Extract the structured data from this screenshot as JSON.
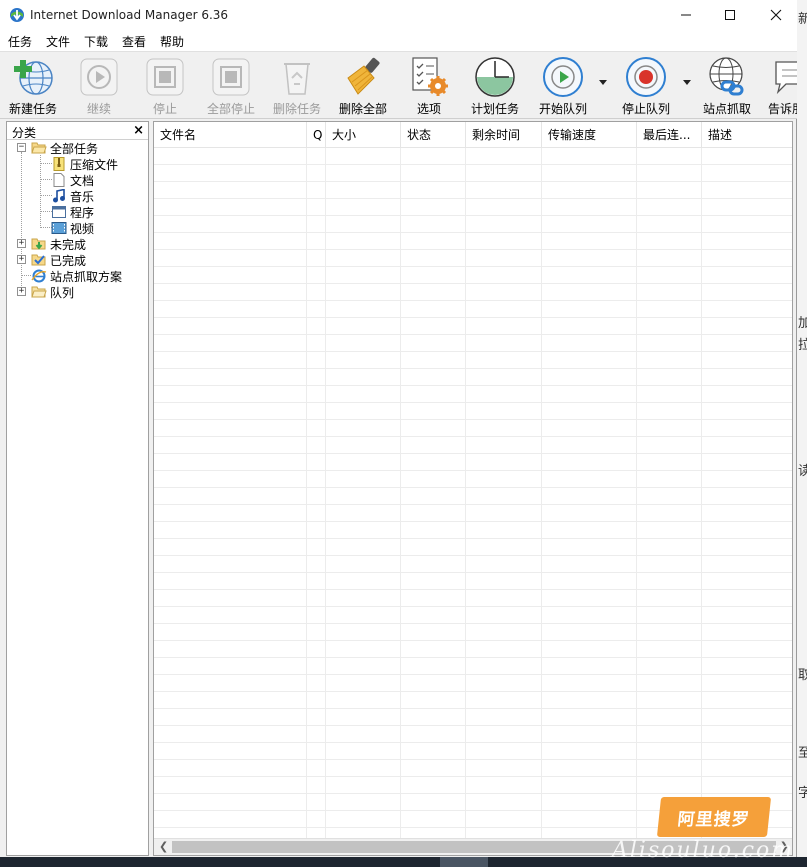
{
  "window": {
    "title": "Internet Download Manager 6.36"
  },
  "menu": [
    "任务",
    "文件",
    "下载",
    "查看",
    "帮助"
  ],
  "toolbar": [
    {
      "label": "新建任务",
      "icon": "add-download-icon",
      "enabled": true
    },
    {
      "label": "继续",
      "icon": "resume-icon",
      "enabled": false
    },
    {
      "label": "停止",
      "icon": "stop-icon",
      "enabled": false
    },
    {
      "label": "全部停止",
      "icon": "stop-all-icon",
      "enabled": false
    },
    {
      "label": "删除任务",
      "icon": "recycle-bin-icon",
      "enabled": false
    },
    {
      "label": "删除全部",
      "icon": "broom-icon",
      "enabled": true
    },
    {
      "label": "选项",
      "icon": "options-gear-icon",
      "enabled": true
    },
    {
      "label": "计划任务",
      "icon": "scheduler-clock-icon",
      "enabled": true
    },
    {
      "label": "开始队列",
      "icon": "start-queue-icon",
      "enabled": true
    },
    {
      "label": "停止队列",
      "icon": "stop-queue-icon",
      "enabled": true
    },
    {
      "label": "站点抓取",
      "icon": "site-grabber-icon",
      "enabled": true
    },
    {
      "label": "告诉朋",
      "icon": "tell-friend-icon",
      "enabled": true
    }
  ],
  "sidebar": {
    "title": "分类",
    "close": "×",
    "tree": [
      {
        "label": "全部任务",
        "icon": "open-folder-icon"
      },
      {
        "label": "压缩文件",
        "icon": "archive-icon"
      },
      {
        "label": "文档",
        "icon": "document-icon"
      },
      {
        "label": "音乐",
        "icon": "music-note-icon"
      },
      {
        "label": "程序",
        "icon": "program-window-icon"
      },
      {
        "label": "视频",
        "icon": "video-film-icon"
      },
      {
        "label": "未完成",
        "icon": "unfinished-folder-icon"
      },
      {
        "label": "已完成",
        "icon": "finished-folder-icon"
      },
      {
        "label": "站点抓取方案",
        "icon": "ie-globe-icon"
      },
      {
        "label": "队列",
        "icon": "queue-folder-icon"
      }
    ]
  },
  "list": {
    "columns": [
      "文件名",
      "Q",
      "大小",
      "状态",
      "剩余时间",
      "传输速度",
      "最后连...",
      "描述"
    ],
    "rows": []
  },
  "watermark": {
    "text": "阿里搜罗",
    "sub": "Alisouluo.com"
  },
  "background_right": [
    "新",
    "加",
    "拉",
    "读",
    "取",
    "至",
    "字"
  ],
  "colors": {
    "accent_green": "#3aa54a",
    "stop_red": "#d9332b",
    "queue_blue": "#2f7fd1",
    "watermark": "#f5a03a"
  }
}
